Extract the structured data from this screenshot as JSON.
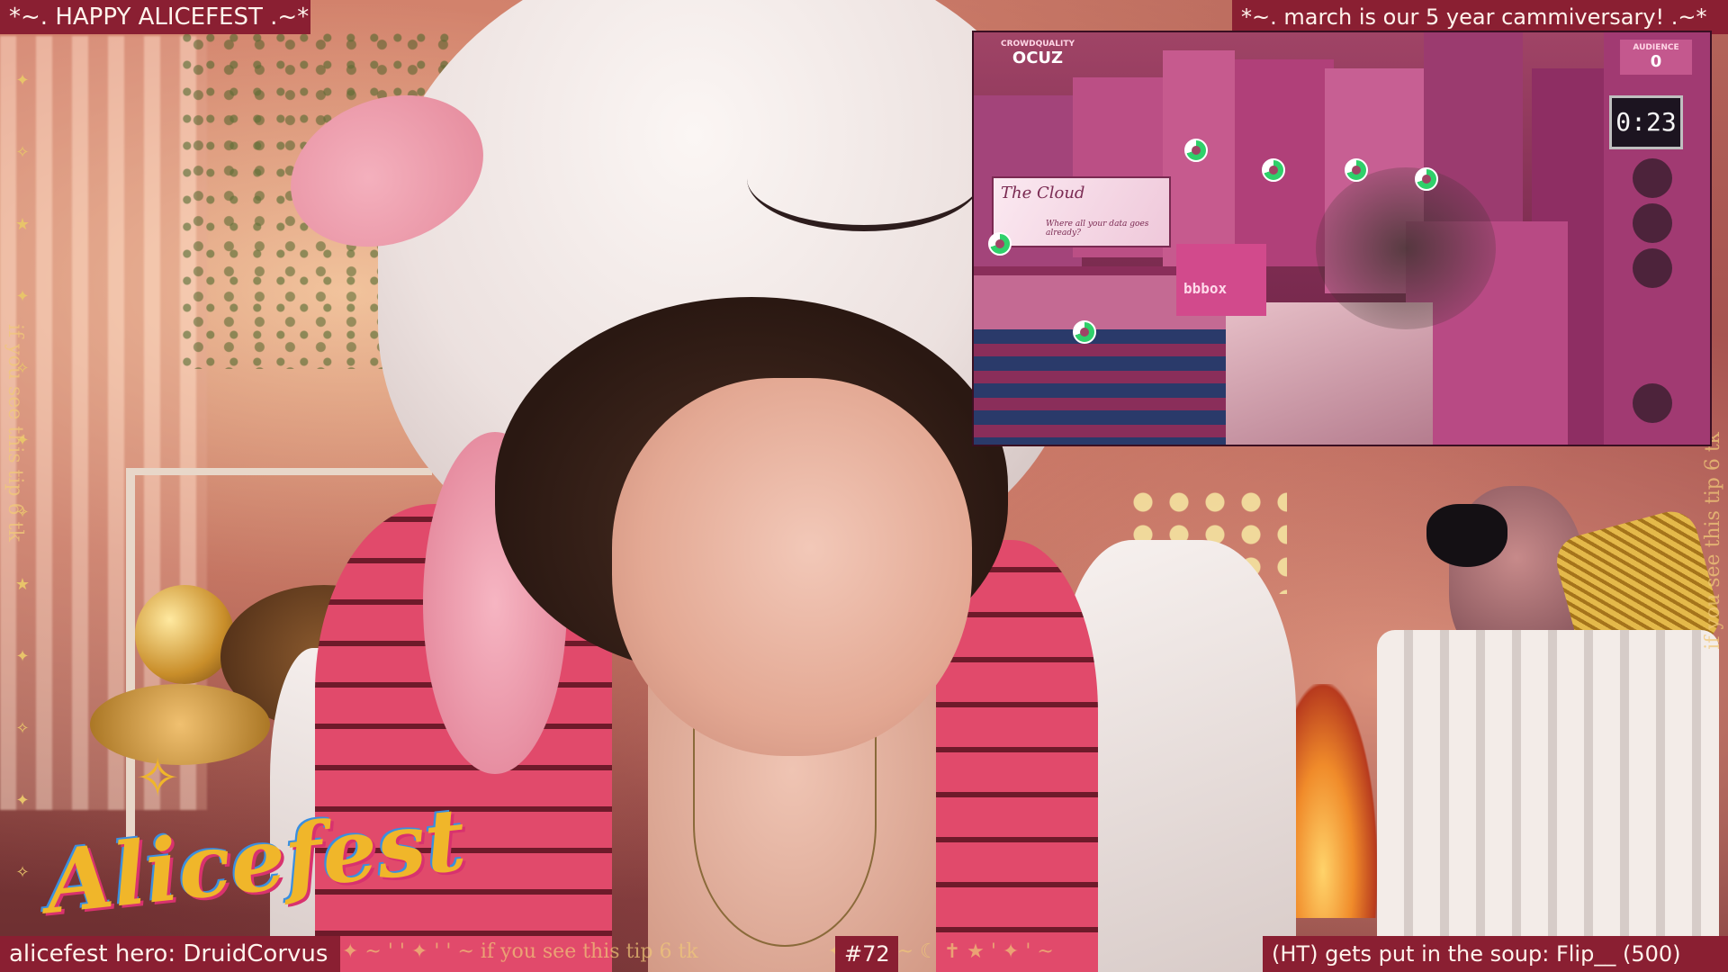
{
  "top_banners": {
    "left": "*~. HAPPY ALICEFEST .~*",
    "right": "*~. march is our 5 year cammiversary! .~*"
  },
  "game": {
    "score_label": "CROWDQUALITY",
    "score_value": "OCUZ",
    "audience_label": "AUDIENCE",
    "audience_value": "0",
    "timer": "0:23",
    "sign_title": "The Cloud",
    "sign_subtitle": "Where all your data goes already?",
    "shop_sign": "bbbox"
  },
  "side_text": "if you see this tip 6 tk",
  "logo": {
    "text": "Alicefest"
  },
  "bottom": {
    "hero": "alicefest hero: DruidCorvus",
    "ticker": "✦ ~ ' ' ✦ ' ' ~ if you see this tip 6 tk",
    "goal_number": "#72",
    "ticker_right": "✦ ~ ' ' ~ ☾ ✝ ★ ' ✦ ' ~",
    "soup": "(HT) gets put in the soup: Flip__ (500)"
  },
  "colors": {
    "banner_bg": "#8a1f32",
    "banner_text": "#fff3ec",
    "game_accent": "#a04466",
    "logo_gold": "#f0b62a"
  }
}
